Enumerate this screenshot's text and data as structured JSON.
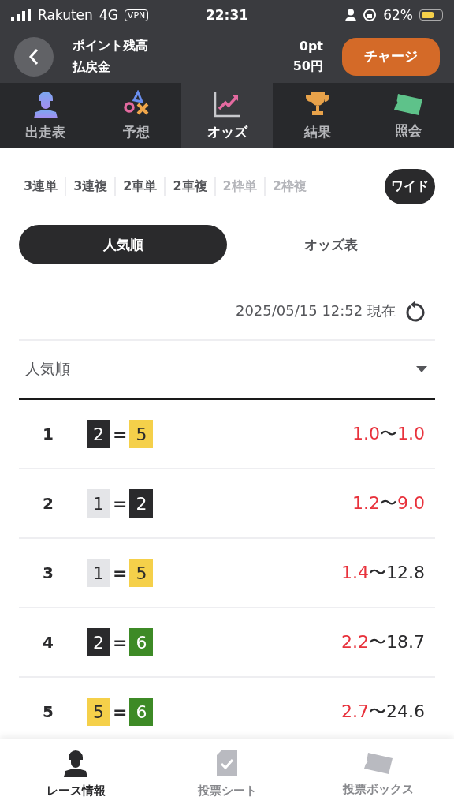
{
  "status_bar": {
    "carrier": "Rakuten",
    "network": "4G",
    "vpn": "VPN",
    "time": "22:31",
    "battery": "62%"
  },
  "header": {
    "rows": [
      {
        "label": "ポイント残高",
        "value": "0pt"
      },
      {
        "label": "払戻金",
        "value": "50円"
      }
    ],
    "charge_button": "チャージ"
  },
  "category_tabs": [
    {
      "label": "出走表",
      "kind": "rider",
      "selected": false
    },
    {
      "label": "予想",
      "kind": "symbols",
      "selected": false
    },
    {
      "label": "オッズ",
      "kind": "chart",
      "selected": true
    },
    {
      "label": "結果",
      "kind": "trophy",
      "selected": false
    },
    {
      "label": "照会",
      "kind": "ticket",
      "selected": false
    }
  ],
  "bet_types": [
    {
      "label": "3連単",
      "selected": false,
      "disabled": false
    },
    {
      "label": "3連複",
      "selected": false,
      "disabled": false
    },
    {
      "label": "2車単",
      "selected": false,
      "disabled": false
    },
    {
      "label": "2車複",
      "selected": false,
      "disabled": false
    },
    {
      "label": "2枠単",
      "selected": false,
      "disabled": true
    },
    {
      "label": "2枠複",
      "selected": false,
      "disabled": true
    },
    {
      "label": "ワイド",
      "selected": true,
      "disabled": false
    }
  ],
  "view_toggle": [
    {
      "label": "人気順",
      "selected": true
    },
    {
      "label": "オッズ表",
      "selected": false
    }
  ],
  "timestamp": "2025/05/15 12:52 現在",
  "sort_dropdown": {
    "value": "人気順"
  },
  "odds_rows": [
    {
      "rank": "1",
      "pair": [
        {
          "number": "2",
          "color": "#2a2a2c"
        },
        {
          "number": "5",
          "color": "#f5d04a"
        }
      ],
      "joiner": "=",
      "low": "1.0",
      "low_hot": true,
      "separator": "〜",
      "high": "1.0",
      "high_hot": true
    },
    {
      "rank": "2",
      "pair": [
        {
          "number": "1",
          "color": "#e4e5e8"
        },
        {
          "number": "2",
          "color": "#2a2a2c"
        }
      ],
      "joiner": "=",
      "low": "1.2",
      "low_hot": true,
      "separator": "〜",
      "high": "9.0",
      "high_hot": true
    },
    {
      "rank": "3",
      "pair": [
        {
          "number": "1",
          "color": "#e4e5e8"
        },
        {
          "number": "5",
          "color": "#f5d04a"
        }
      ],
      "joiner": "=",
      "low": "1.4",
      "low_hot": true,
      "separator": "〜",
      "high": "12.8",
      "high_hot": false
    },
    {
      "rank": "4",
      "pair": [
        {
          "number": "2",
          "color": "#2a2a2c"
        },
        {
          "number": "6",
          "color": "#3d8a26"
        }
      ],
      "joiner": "=",
      "low": "2.2",
      "low_hot": true,
      "separator": "〜",
      "high": "18.7",
      "high_hot": false
    },
    {
      "rank": "5",
      "pair": [
        {
          "number": "5",
          "color": "#f5d04a"
        },
        {
          "number": "6",
          "color": "#3d8a26"
        }
      ],
      "joiner": "=",
      "low": "2.7",
      "low_hot": true,
      "separator": "〜",
      "high": "24.6",
      "high_hot": false
    }
  ],
  "bottom_nav": [
    {
      "label": "レース情報",
      "kind": "rider",
      "selected": true
    },
    {
      "label": "投票シート",
      "kind": "sheet",
      "selected": false
    },
    {
      "label": "投票ボックス",
      "kind": "ticket",
      "selected": false
    }
  ]
}
